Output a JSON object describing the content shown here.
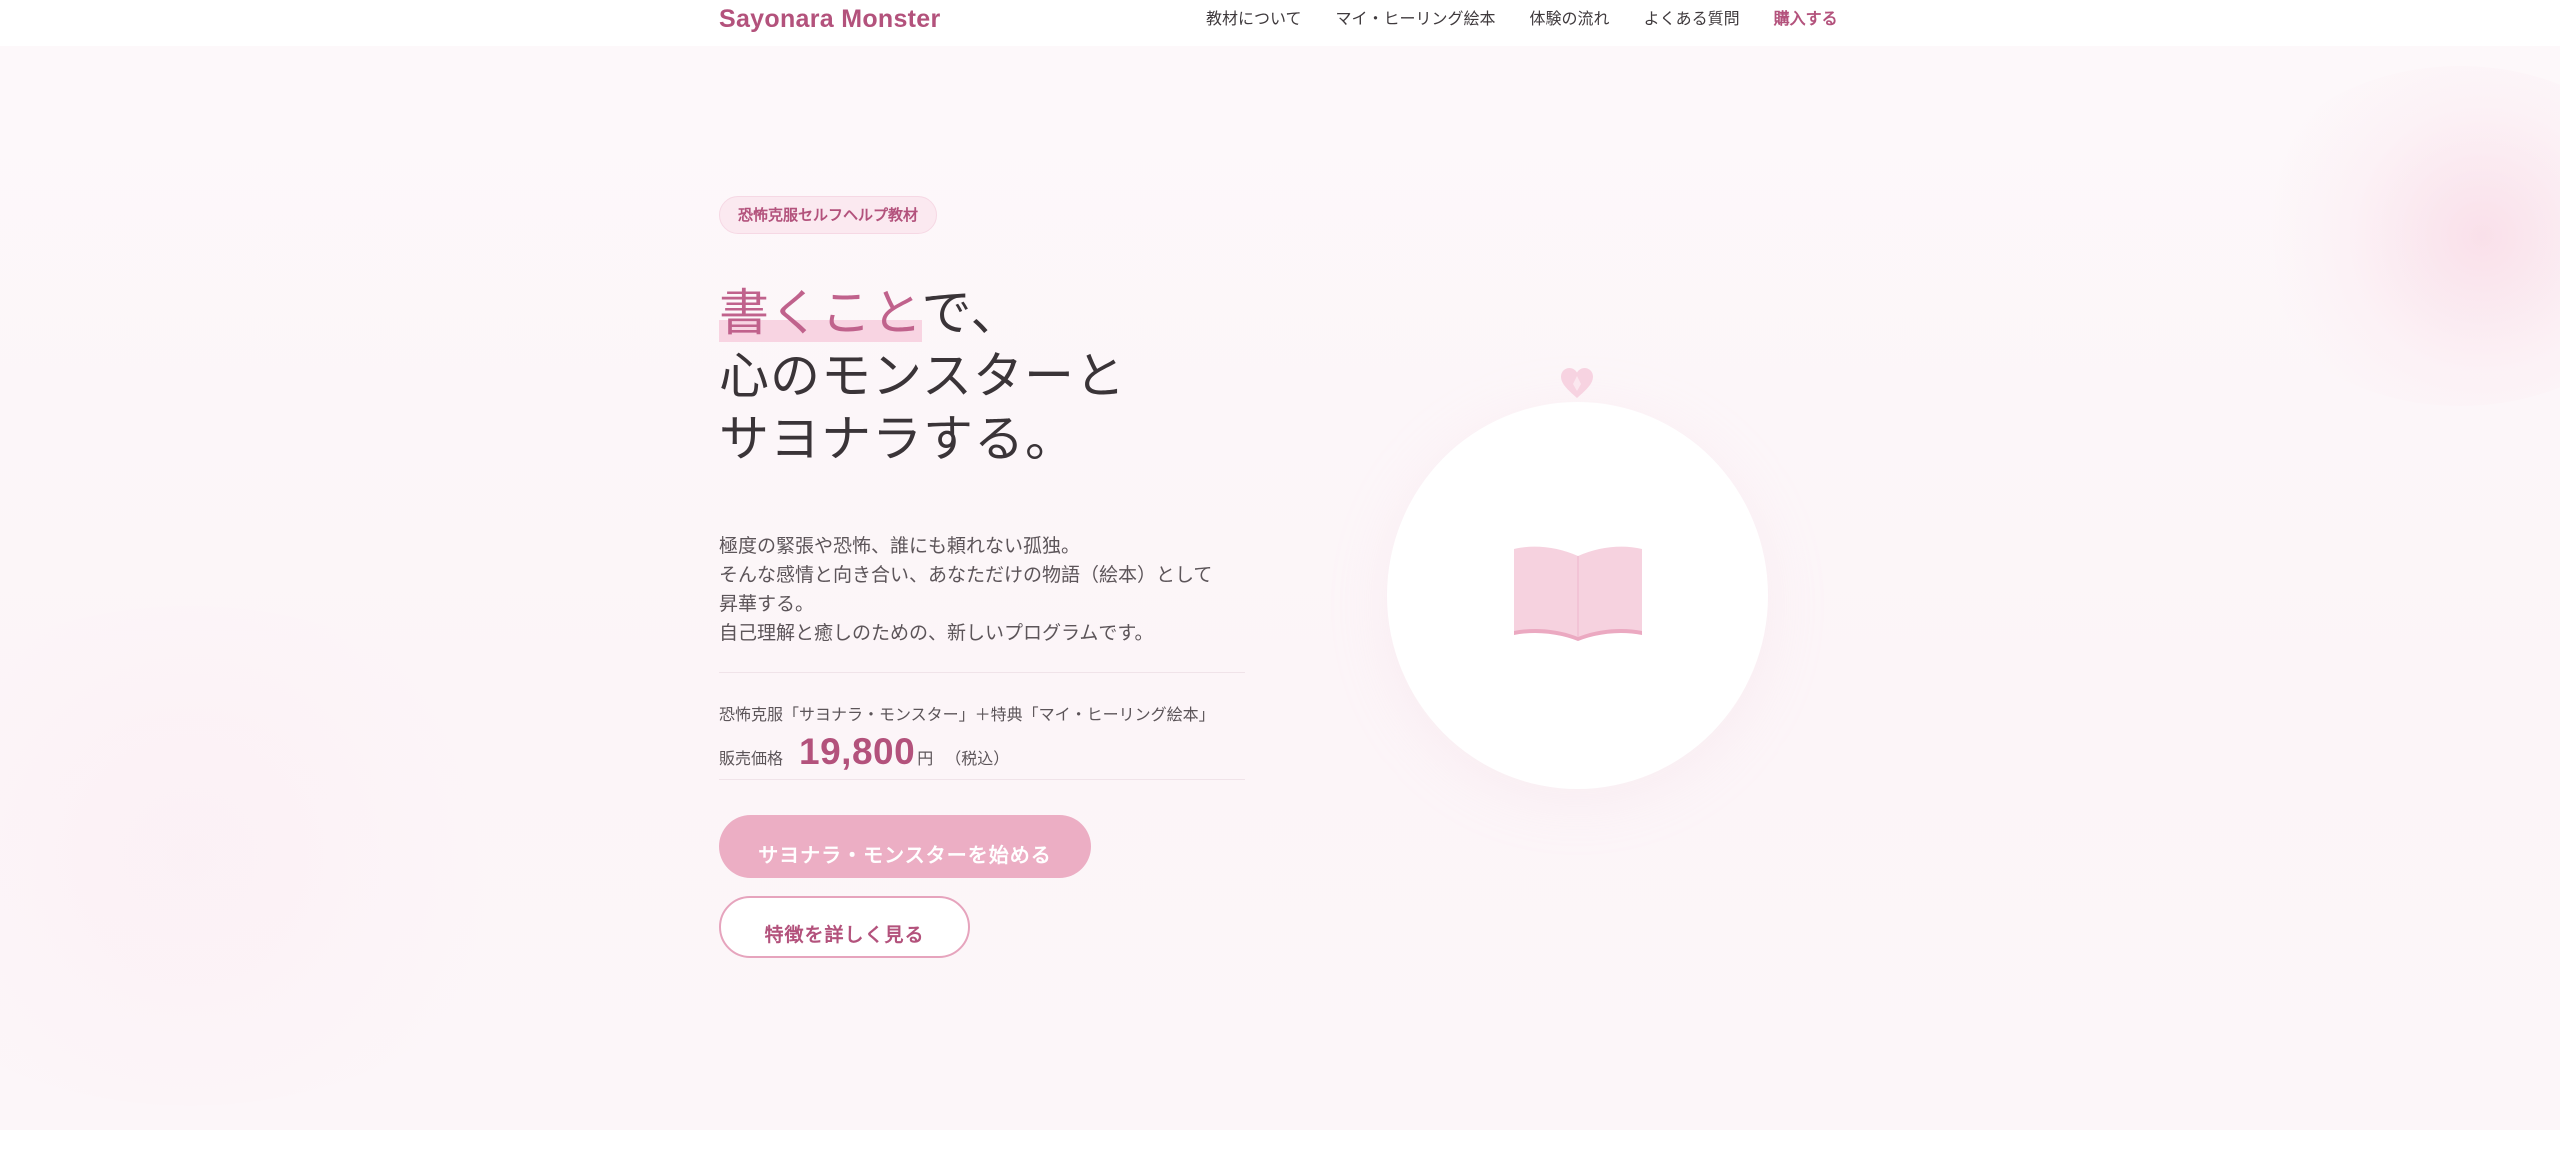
{
  "header": {
    "brand": "Sayonara Monster",
    "nav": [
      {
        "label": "教材について"
      },
      {
        "label": "マイ・ヒーリング絵本"
      },
      {
        "label": "体験の流れ"
      },
      {
        "label": "よくある質問"
      },
      {
        "label": "購入する"
      }
    ]
  },
  "hero": {
    "badge": "恐怖克服セルフヘルプ教材",
    "headline": {
      "accent": "書くこと",
      "line1_rest": "で、",
      "line2": "心のモンスターと",
      "line3": "サヨナラする。"
    },
    "description": [
      "極度の緊張や恐怖、誰にも頼れない孤独。",
      "そんな感情と向き合い、あなただけの物語（絵本）として",
      "昇華する。",
      "自己理解と癒しのための、新しいプログラムです。"
    ],
    "product_name": "恐怖克服「サヨナラ・モンスター」＋特典「マイ・ヒーリング絵本」",
    "price_label": "販売価格",
    "price_value": "19,800",
    "price_unit": "円",
    "price_tax": "（税込）",
    "cta_primary": "サヨナラ・モンスターを始める",
    "cta_secondary": "特徴を詳しく見る"
  },
  "illustration": {
    "top_icon": "heart-icon",
    "center_icon": "open-book-icon"
  },
  "colors": {
    "brand": "#b3527c",
    "accent_pink": "#ecaec4",
    "hero_bg": "#fdf8fa"
  }
}
